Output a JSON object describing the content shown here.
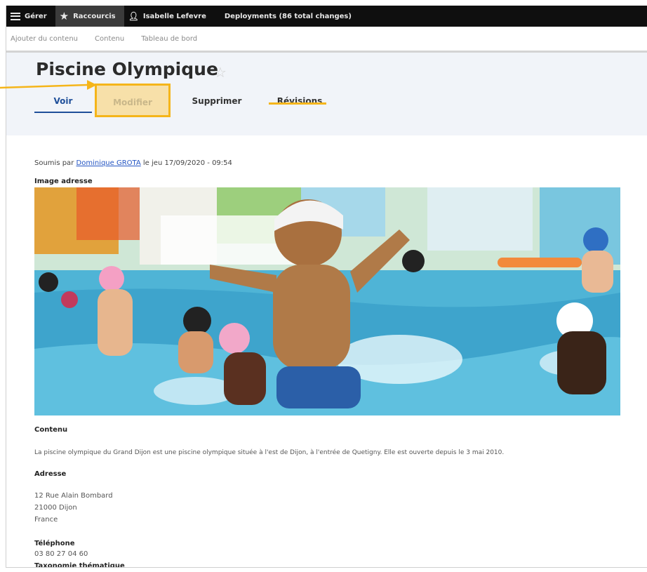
{
  "toolbar": {
    "manage_label": "Gérer",
    "shortcuts_label": "Raccourcis",
    "user_label": "Isabelle Lefevre",
    "deployments_label": "Deployments (86 total changes)"
  },
  "tray": {
    "items": [
      {
        "label": "Ajouter du contenu"
      },
      {
        "label": "Contenu"
      },
      {
        "label": "Tableau de bord"
      }
    ]
  },
  "page": {
    "title": "Piscine Olympique",
    "tabs": [
      {
        "label": "Voir"
      },
      {
        "label": "Modifier"
      },
      {
        "label": "Supprimer"
      },
      {
        "label": "Révisions"
      }
    ]
  },
  "node": {
    "submitted_prefix": "Soumis par",
    "author": "Dominique GROTA",
    "submitted_suffix": "le jeu 17/09/2020 - 09:54",
    "image_label": "Image adresse",
    "content_label": "Contenu",
    "content_text": "La piscine olympique du Grand Dijon est une piscine olympique située à l'est de Dijon, à l'entrée de Quetigny. Elle est ouverte depuis le 3 mai 2010.",
    "address_label": "Adresse",
    "address_lines": [
      "12 Rue Alain Bombard",
      "21000 Dijon",
      "France"
    ],
    "phone_label": "Téléphone",
    "phone": "03 80 27 04 60",
    "taxonomy_label": "Taxonomie thématique"
  },
  "colors": {
    "highlight": "#f5b51a",
    "link": "#2455c3",
    "toolbar_bg": "#0f0f0f"
  }
}
